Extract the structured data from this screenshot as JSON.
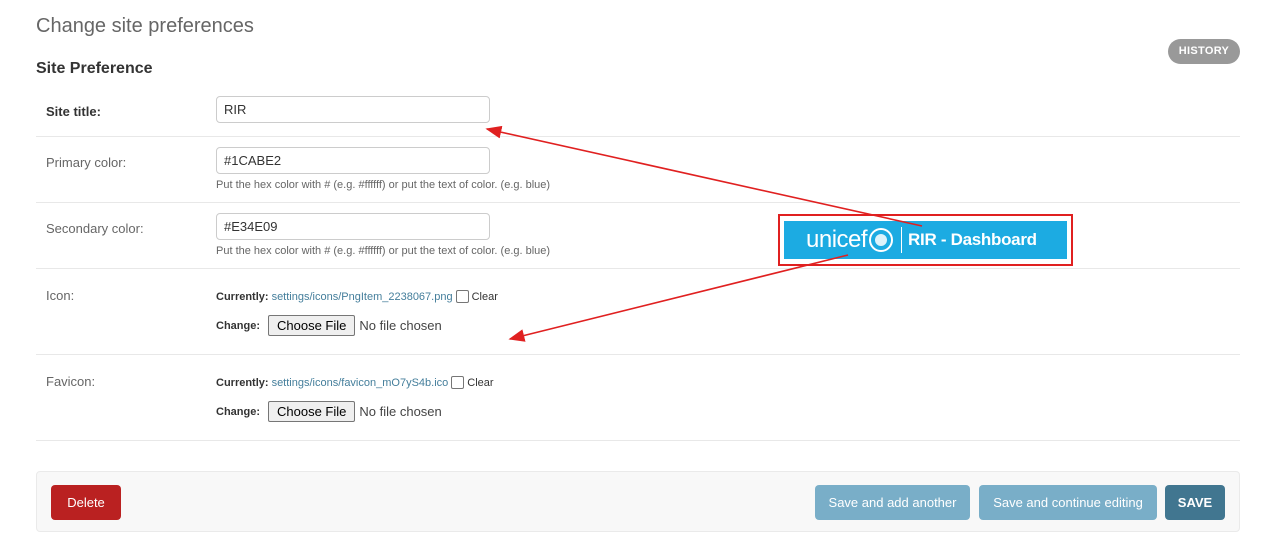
{
  "page": {
    "title": "Change site preferences",
    "history_label": "HISTORY",
    "section_title": "Site Preference"
  },
  "fields": {
    "site_title": {
      "label": "Site title:",
      "value": "RIR"
    },
    "primary_color": {
      "label": "Primary color:",
      "value": "#1CABE2",
      "help": "Put the hex color with # (e.g. #ffffff) or put the text of color. (e.g. blue)"
    },
    "secondary_color": {
      "label": "Secondary color:",
      "value": "#E34E09",
      "help": "Put the hex color with # (e.g. #ffffff) or put the text of color. (e.g. blue)"
    },
    "icon": {
      "label": "Icon:",
      "currently_label": "Currently:",
      "current_file": "settings/icons/PngItem_2238067.png",
      "clear_label": "Clear",
      "change_label": "Change:",
      "choose_label": "Choose File",
      "no_file": "No file chosen"
    },
    "favicon": {
      "label": "Favicon:",
      "currently_label": "Currently:",
      "current_file": "settings/icons/favicon_mO7yS4b.ico",
      "clear_label": "Clear",
      "change_label": "Change:",
      "choose_label": "Choose File",
      "no_file": "No file chosen"
    }
  },
  "actions": {
    "delete": "Delete",
    "save_add": "Save and add another",
    "save_continue": "Save and continue editing",
    "save": "SAVE"
  },
  "overlay": {
    "logo_text": "unicef",
    "dashboard_title": "RIR - Dashboard"
  },
  "colors": {
    "brand_blue": "#1CABE2",
    "delete_red": "#ba2121",
    "save_blue": "#417690",
    "light_button": "#79aec8",
    "annotation_red": "#e02020"
  }
}
